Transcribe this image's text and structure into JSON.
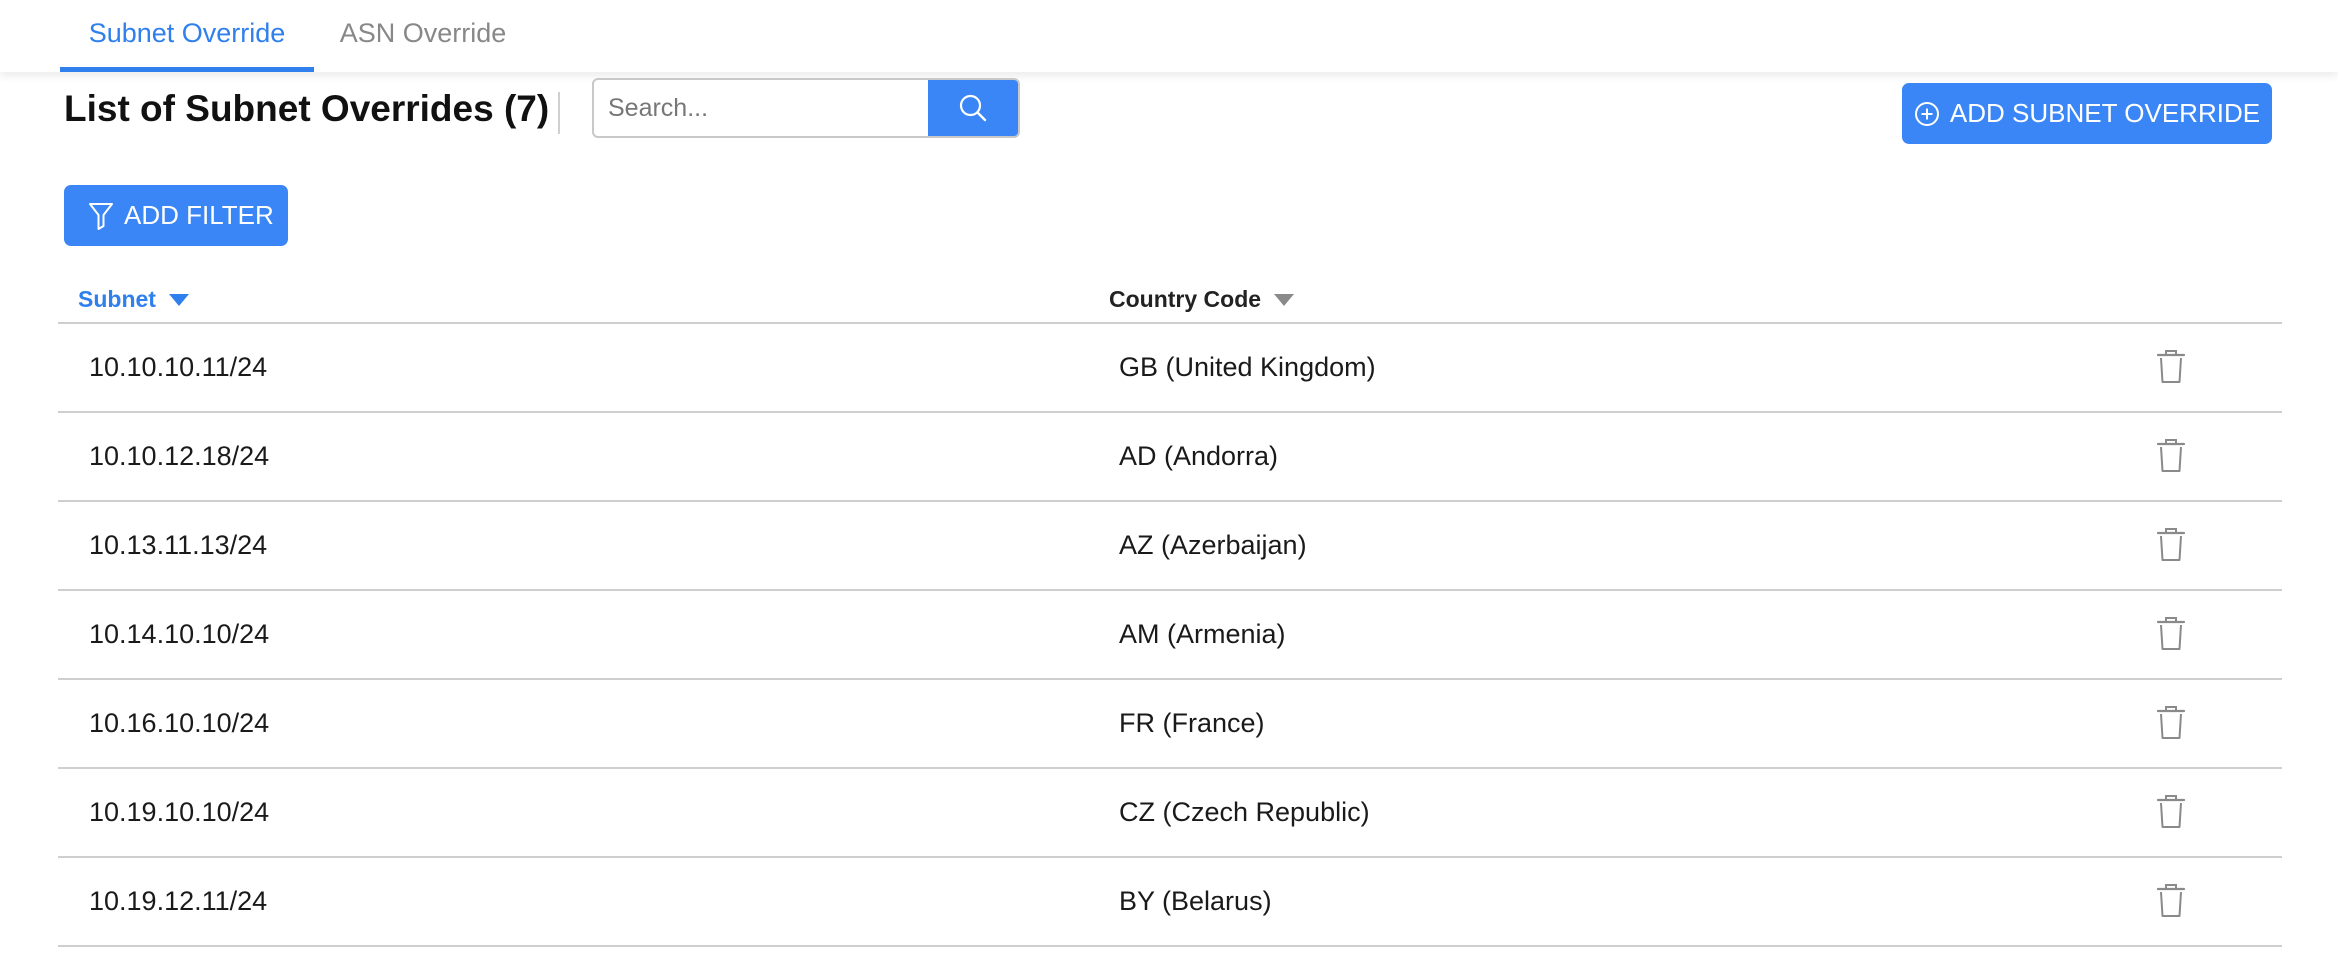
{
  "tabs": [
    {
      "label": "Subnet Override",
      "active": true
    },
    {
      "label": "ASN Override",
      "active": false
    }
  ],
  "header": {
    "title": "List of Subnet Overrides (7)",
    "search_placeholder": "Search...",
    "search_value": "",
    "add_button_label": "ADD SUBNET OVERRIDE",
    "filter_button_label": "ADD FILTER"
  },
  "table": {
    "columns": [
      {
        "label": "Subnet",
        "sorted": true
      },
      {
        "label": "Country Code",
        "sorted": false
      }
    ],
    "rows": [
      {
        "subnet": "10.10.10.11/24",
        "country": "GB (United Kingdom)"
      },
      {
        "subnet": "10.10.12.18/24",
        "country": "AD (Andorra)"
      },
      {
        "subnet": "10.13.11.13/24",
        "country": "AZ (Azerbaijan)"
      },
      {
        "subnet": "10.14.10.10/24",
        "country": "AM (Armenia)"
      },
      {
        "subnet": "10.16.10.10/24",
        "country": "FR (France)"
      },
      {
        "subnet": "10.19.10.10/24",
        "country": "CZ (Czech Republic)"
      },
      {
        "subnet": "10.19.12.11/24",
        "country": "BY (Belarus)"
      }
    ]
  },
  "icons": {
    "search": "search-icon",
    "add": "plus-circle-icon",
    "filter": "filter-icon",
    "sort": "caret-down-icon",
    "delete": "trash-icon"
  },
  "colors": {
    "accent": "#3a86f7",
    "active_tab": "#2f80ed",
    "inactive_tab": "#888888",
    "divider": "#cfcfcf"
  }
}
